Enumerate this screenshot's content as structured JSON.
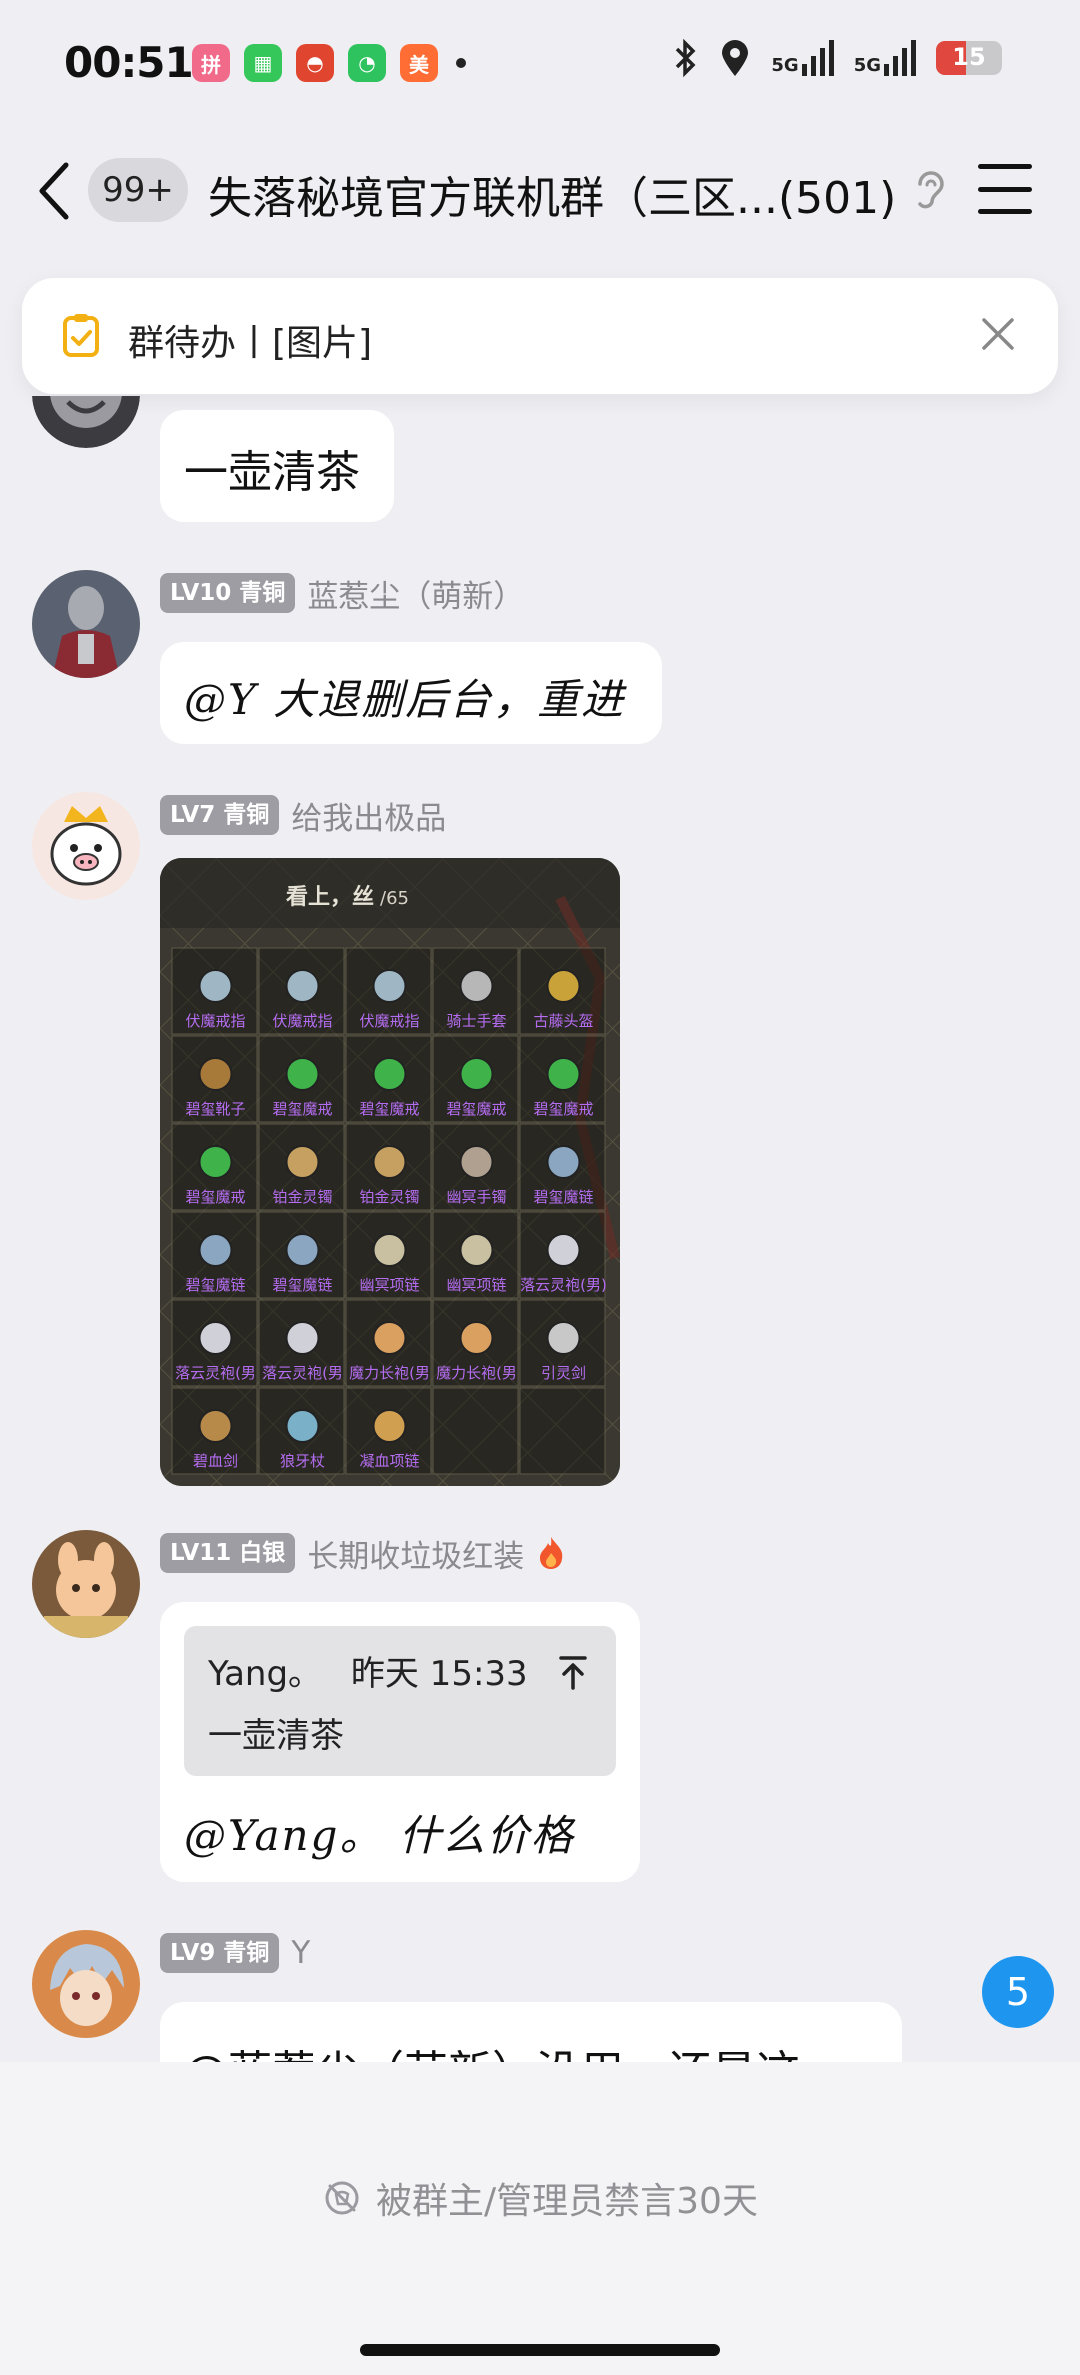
{
  "status_bar": {
    "time": "00:51",
    "network_1": "5G",
    "network_2": "5G",
    "battery": "15"
  },
  "header": {
    "unread_badge": "99+",
    "title": "失落秘境官方联机群（三区...(501)"
  },
  "todo": {
    "text": "群待办丨[图片]"
  },
  "messages": [
    {
      "text": "一壶清茶"
    },
    {
      "level": "LV10 青铜",
      "nickname": "蓝惹尘（萌新）",
      "text": "@Y 大退删后台，重进"
    },
    {
      "level": "LV7 青铜",
      "nickname": "给我出极品",
      "image": {
        "header": "看上，丝",
        "count": "/65",
        "items": [
          "伏魔戒指",
          "伏魔戒指",
          "伏魔戒指",
          "骑士手套",
          "古藤头盔",
          "碧玺靴子",
          "碧玺魔戒",
          "碧玺魔戒",
          "碧玺魔戒",
          "碧玺魔戒",
          "碧玺魔戒",
          "铂金灵镯",
          "铂金灵镯",
          "幽冥手镯",
          "碧玺魔链",
          "碧玺魔链",
          "碧玺魔链",
          "幽冥项链",
          "幽冥项链",
          "落云灵袍(男)",
          "落云灵袍(男",
          "落云灵袍(男",
          "魔力长袍(男",
          "魔力长袍(男",
          "引灵剑",
          "碧血剑",
          "狼牙杖",
          "凝血项链"
        ]
      }
    },
    {
      "level": "LV11 白银",
      "nickname": "长期收垃圾红装",
      "quote": {
        "author": "Yang。",
        "time": "昨天 15:33",
        "text": "一壶清茶"
      },
      "text": "@Yang。 什么价格"
    },
    {
      "level": "LV9 青铜",
      "nickname": "Y",
      "text": "@蓝惹尘（萌新）没用，还是这"
    }
  ],
  "unread_count": "5",
  "bottom": {
    "muted_text": "被群主/管理员禁言30天"
  }
}
